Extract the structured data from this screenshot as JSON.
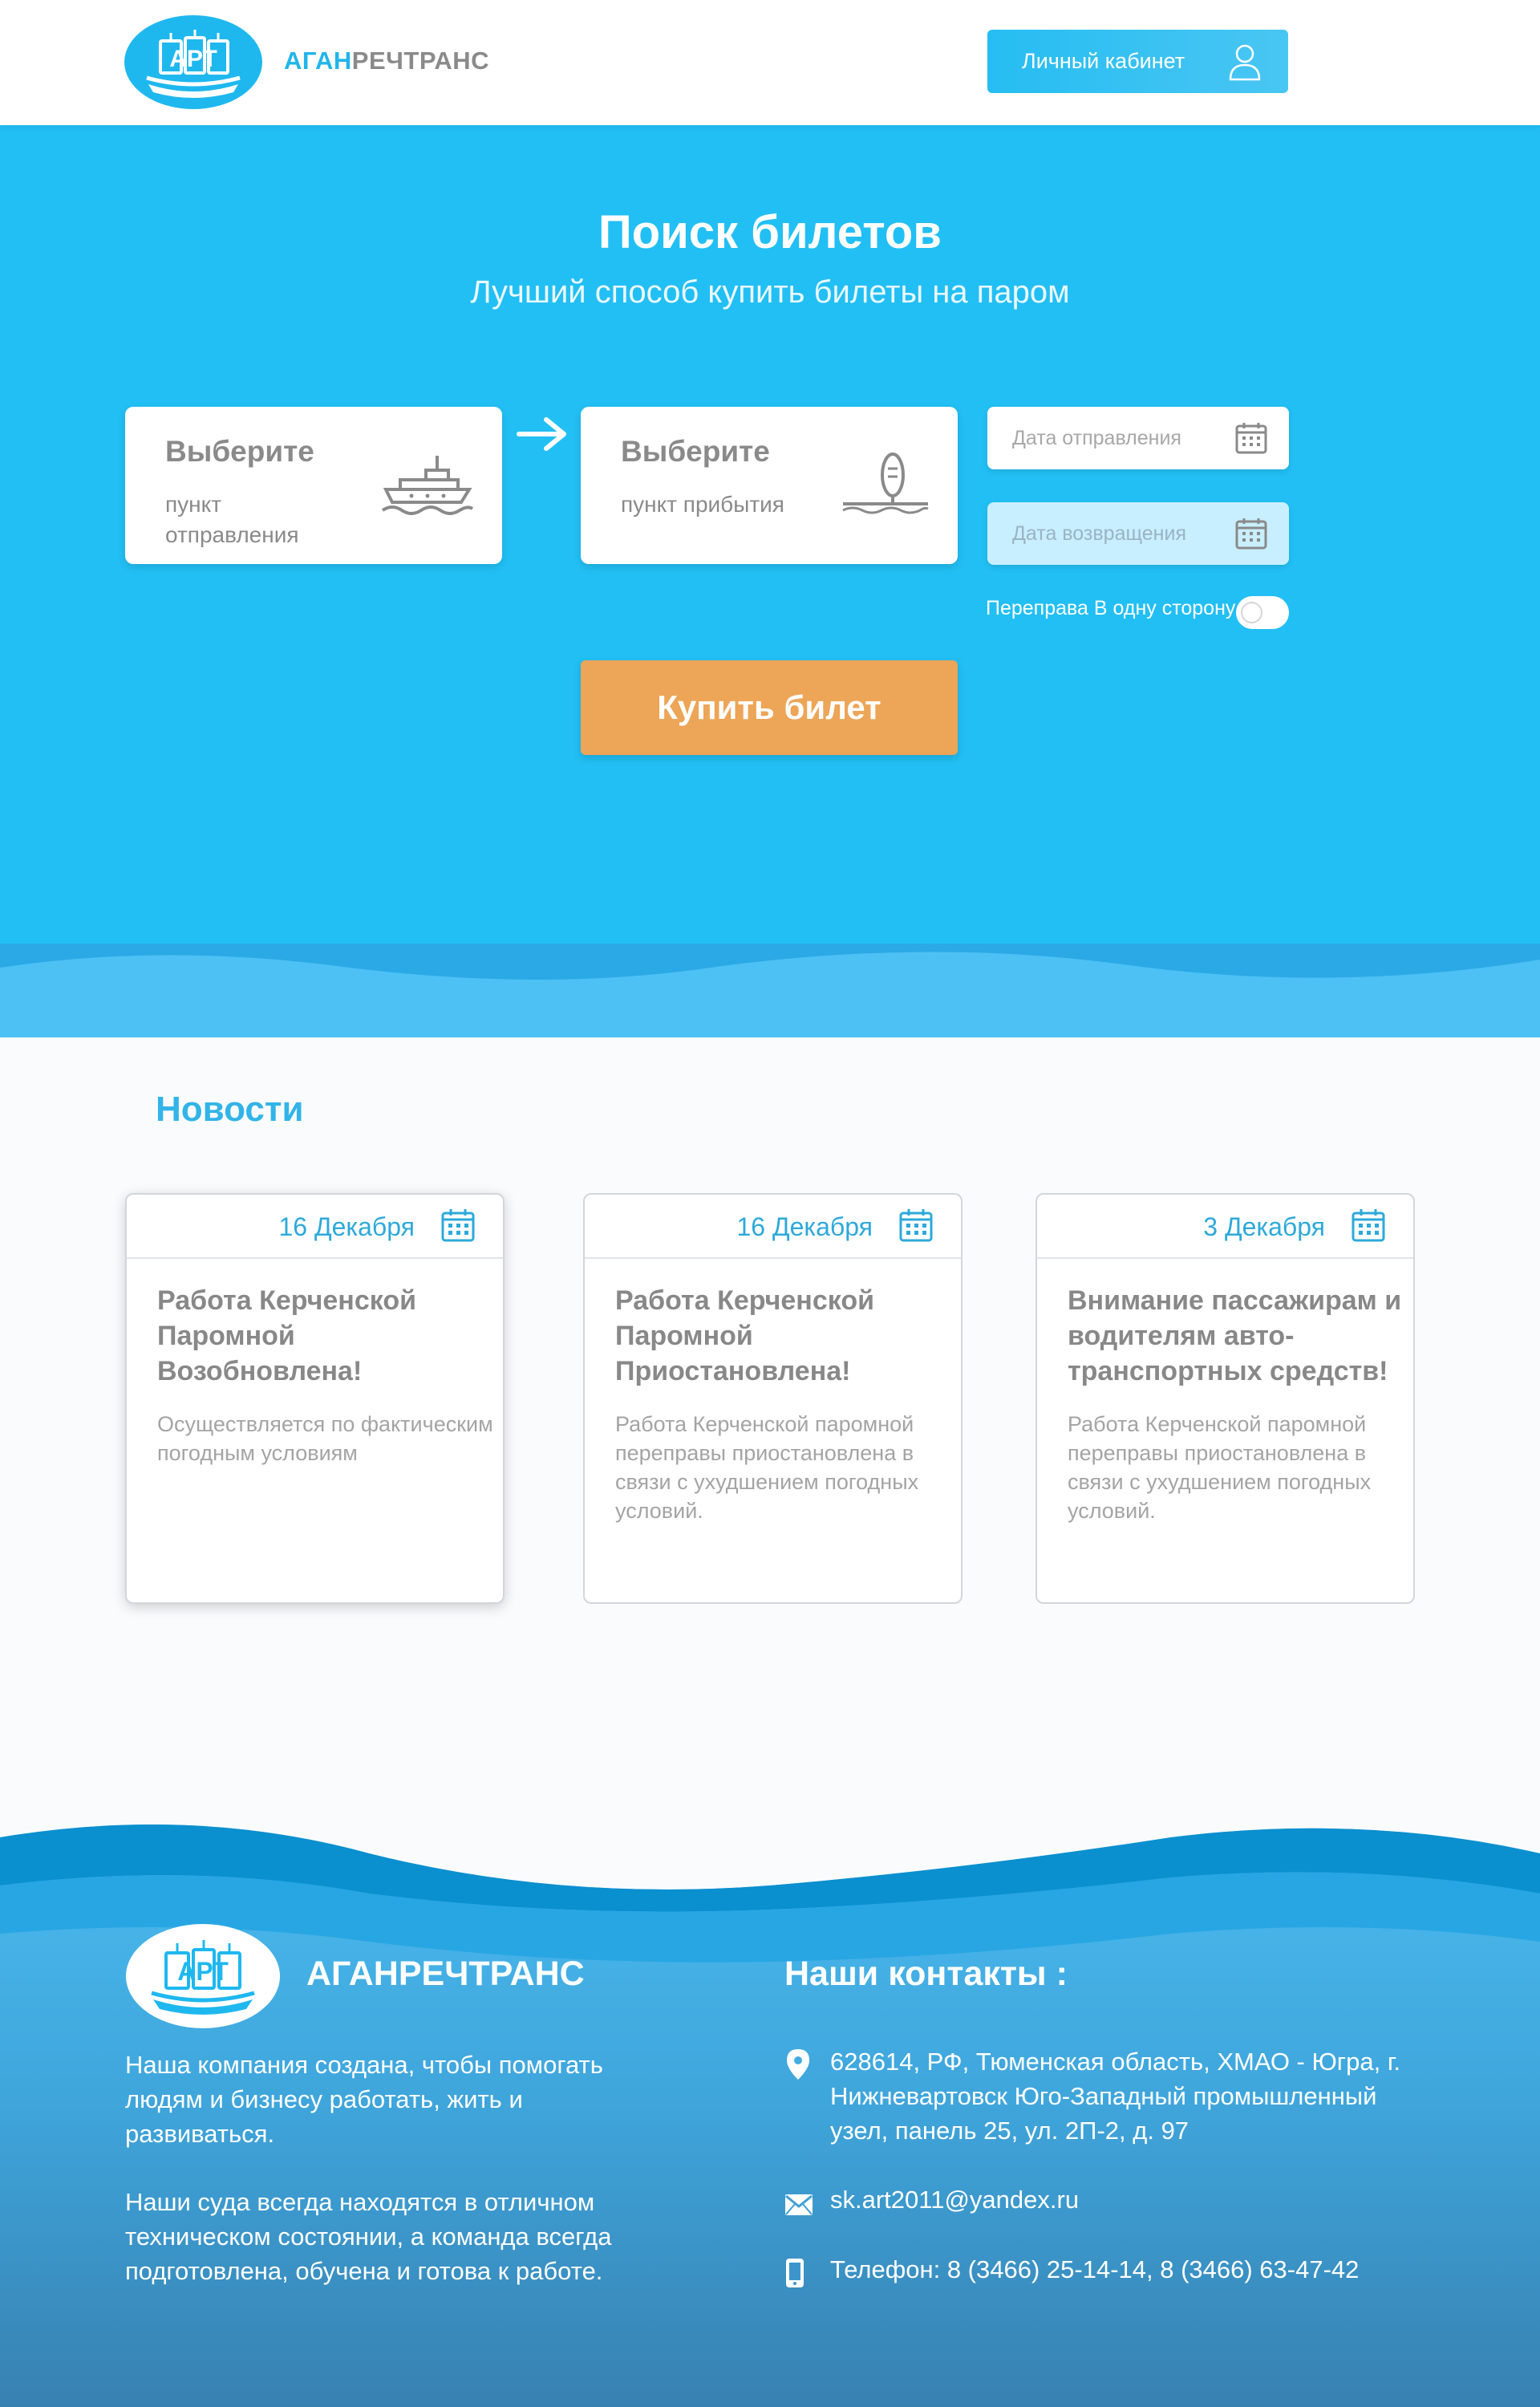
{
  "header": {
    "logo_text": "АРТ",
    "brand_part1": "АГАН",
    "brand_part2": "РЕЧТРАНС",
    "cabinet_label": "Личный кабинет"
  },
  "search": {
    "title": "Поиск билетов",
    "subtitle": "Лучший способ купить билеты на паром",
    "from": {
      "title": "Выберите",
      "subtitle": "пункт отправления"
    },
    "to": {
      "title": "Выберите",
      "subtitle": "пункт прибытия"
    },
    "departure_placeholder": "Дата отправления",
    "return_placeholder": "Дата возвращения",
    "oneway_label": "Переправа В одну сторону",
    "oneway_enabled": false,
    "buy_label": "Купить билет"
  },
  "news": {
    "title": "Новости",
    "items": [
      {
        "date": "16 Декабря",
        "title": "Работа Керченской Паромной Возобновлена!",
        "text": "Осуществляется по фактическим погодным условиям"
      },
      {
        "date": "16 Декабря",
        "title": "Работа Керченской Паромной Приостановлена!",
        "text": "Работа Керченской паромной переправы приостановлена в связи с ухудшением погодных условий."
      },
      {
        "date": "3 Декабря",
        "title": "Внимание пассажирам и водителям авто-транспортных средств!",
        "text": "Работа Керченской паромной переправы приостановлена в связи с ухудшением погодных условий."
      }
    ]
  },
  "footer": {
    "logo_text": "АРТ",
    "brand": "АГАНРЕЧТРАНС",
    "about1": "Наша компания создана, чтобы помогать людям и бизнесу работать, жить и развиваться.",
    "about2": "Наши суда всегда находятся в отличном техническом состоянии, а команда всегда подготовлена, обучена и готова к работе.",
    "contacts_title": "Наши контакты :",
    "address": "628614, РФ, Тюменская область, ХМАО - Югра, г. Нижневартовск Юго-Западный промышленный узел, панель 25, ул. 2П-2, д. 97",
    "email": "sk.art2011@yandex.ru",
    "phone": "Телефон: 8 (3466) 25-14-14, 8 (3466) 63-47-42"
  },
  "colors": {
    "accent": "#22bff4",
    "button": "#eda557",
    "news_title": "#32b4e8"
  }
}
